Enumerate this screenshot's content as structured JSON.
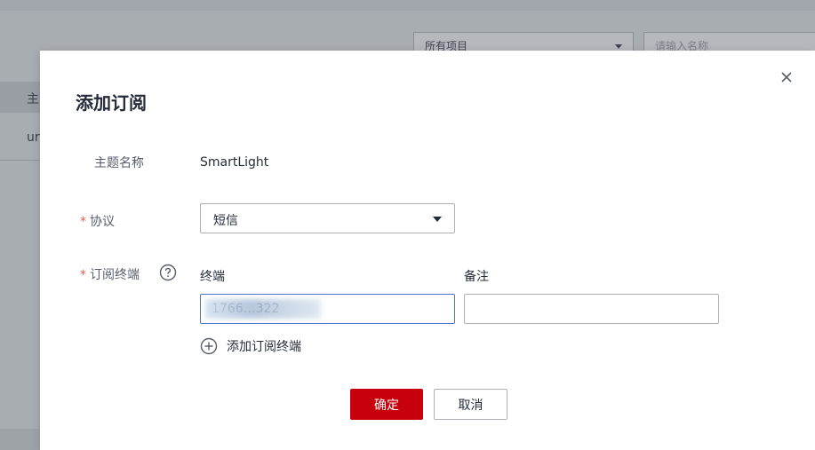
{
  "background": {
    "project_select": "所有项目",
    "search_placeholder": "请输入名称",
    "table_header": "主",
    "table_cell": "ur"
  },
  "dialog": {
    "title": "添加订阅",
    "topic_label": "主题名称",
    "topic_value": "SmartLight",
    "required_mark": "*",
    "protocol_label": "协议",
    "protocol_value": "短信",
    "endpoints_label": "订阅终端",
    "endpoint_column": "终端",
    "remark_column": "备注",
    "endpoint_value": "1766…322",
    "remark_value": "",
    "add_endpoint": "添加订阅终端",
    "confirm": "确定",
    "cancel": "取消"
  },
  "colors": {
    "primary": "#c7000b",
    "required": "#e35d52",
    "focus_border": "#526ecc"
  },
  "icons": {
    "close": "close-icon",
    "help": "question-circle-icon",
    "add": "plus-circle-icon",
    "caret": "chevron-down-icon"
  }
}
